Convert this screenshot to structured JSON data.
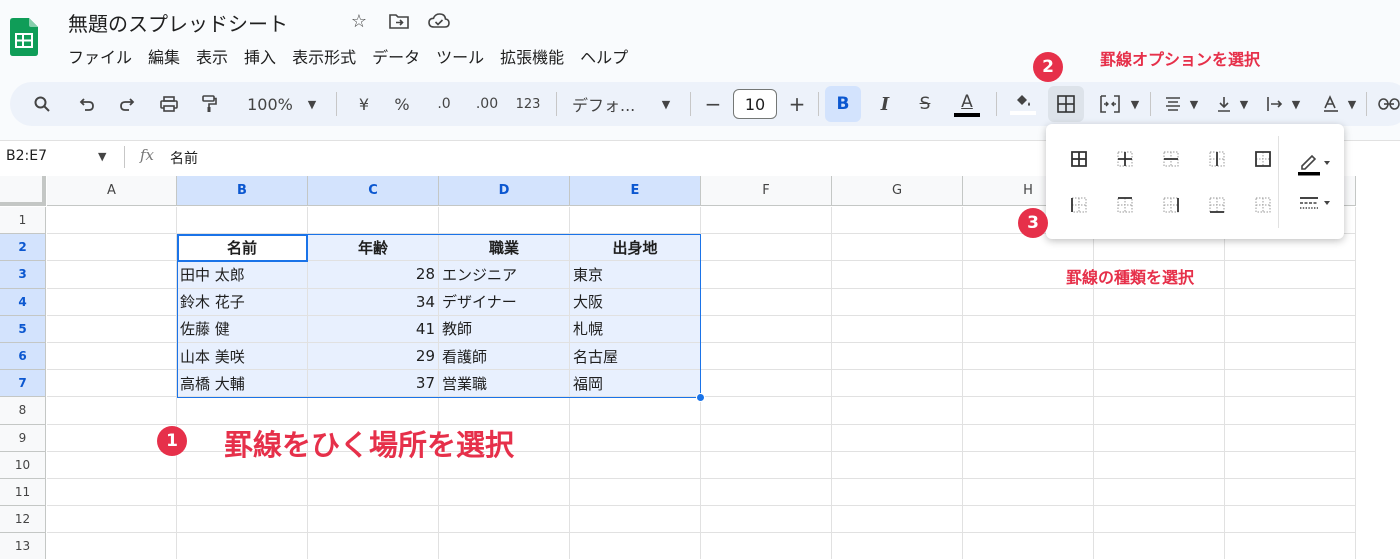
{
  "doc": {
    "title": "無題のスプレッドシート"
  },
  "menu": [
    "ファイル",
    "編集",
    "表示",
    "挿入",
    "表示形式",
    "データ",
    "ツール",
    "拡張機能",
    "ヘルプ"
  ],
  "toolbar": {
    "zoom": "100%",
    "currency": "¥",
    "percent": "%",
    "dec_decrease": ".0",
    "dec_increase": ".00",
    "format_123": "123",
    "font": "デフォ...",
    "minus": "−",
    "font_size": "10",
    "plus": "+",
    "bold": "B",
    "italic": "I",
    "strike": "S",
    "text_color": "A"
  },
  "formula": {
    "namebox": "B2:E7",
    "fx": "fx",
    "value": "名前"
  },
  "columns": [
    "A",
    "B",
    "C",
    "D",
    "E",
    "F",
    "G",
    "H"
  ],
  "rows": [
    "1",
    "2",
    "3",
    "4",
    "5",
    "6",
    "7",
    "8",
    "9",
    "10",
    "11",
    "12",
    "13"
  ],
  "table": {
    "header": [
      "名前",
      "年齢",
      "職業",
      "出身地"
    ],
    "rows": [
      [
        "田中 太郎",
        "28",
        "エンジニア",
        "東京"
      ],
      [
        "鈴木 花子",
        "34",
        "デザイナー",
        "大阪"
      ],
      [
        "佐藤 健",
        "41",
        "教師",
        "札幌"
      ],
      [
        "山本 美咲",
        "29",
        "看護師",
        "名古屋"
      ],
      [
        "高橋 大輔",
        "37",
        "営業職",
        "福岡"
      ]
    ]
  },
  "annotations": {
    "badge1": "1",
    "badge2": "2",
    "badge3": "3",
    "note1": "罫線をひく場所を選択",
    "note2": "罫線オプションを選択",
    "note3": "罫線の種類を選択"
  },
  "colors": {
    "accent": "#1a73e8",
    "annotation": "#e6304a",
    "selection": "#e8f0fe",
    "sheets_green": "#0f9d58"
  }
}
